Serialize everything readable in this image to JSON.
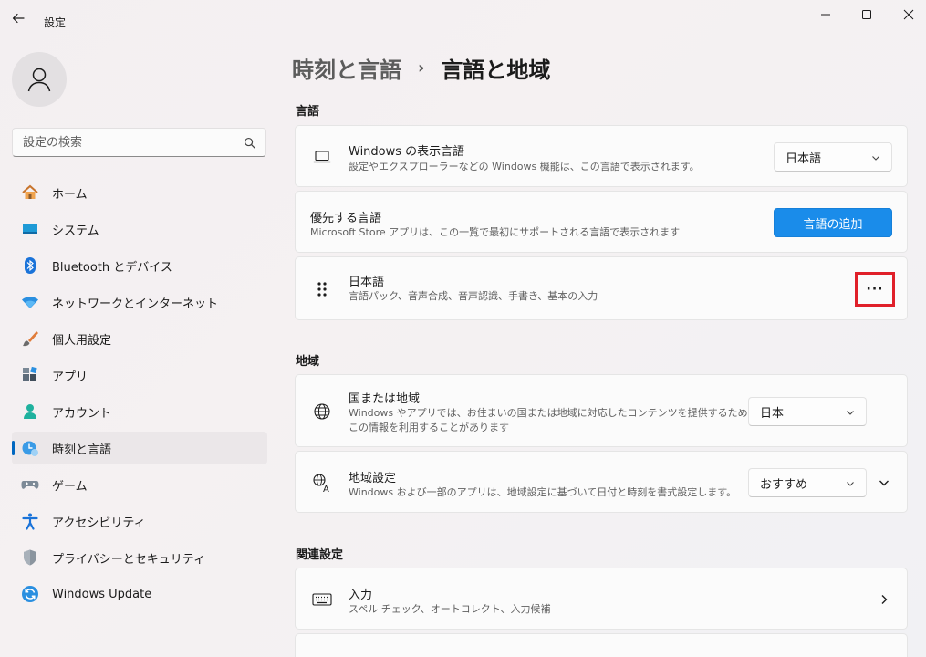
{
  "window": {
    "title": "設定",
    "back_icon": "back-arrow-icon",
    "controls": [
      "minimize-icon",
      "maximize-icon",
      "close-icon"
    ]
  },
  "sidebar": {
    "avatar_icon": "user-icon",
    "search": {
      "placeholder": "設定の検索",
      "value": ""
    },
    "items": [
      {
        "label": "ホーム",
        "icon": "home-icon"
      },
      {
        "label": "システム",
        "icon": "system-icon"
      },
      {
        "label": "Bluetooth とデバイス",
        "icon": "bluetooth-icon"
      },
      {
        "label": "ネットワークとインターネット",
        "icon": "wifi-icon"
      },
      {
        "label": "個人用設定",
        "icon": "brush-icon"
      },
      {
        "label": "アプリ",
        "icon": "apps-icon"
      },
      {
        "label": "アカウント",
        "icon": "account-icon"
      },
      {
        "label": "時刻と言語",
        "icon": "time-language-icon",
        "active": true
      },
      {
        "label": "ゲーム",
        "icon": "gamepad-icon"
      },
      {
        "label": "アクセシビリティ",
        "icon": "accessibility-icon"
      },
      {
        "label": "プライバシーとセキュリティ",
        "icon": "shield-icon"
      },
      {
        "label": "Windows Update",
        "icon": "update-icon"
      }
    ]
  },
  "main": {
    "breadcrumb": {
      "parent": "時刻と言語",
      "separator": "›",
      "current": "言語と地域"
    },
    "language_section": {
      "heading": "言語",
      "display_language": {
        "title": "Windows の表示言語",
        "desc": "設定やエクスプローラーなどの Windows 機能は、この言語で表示されます。",
        "value": "日本語",
        "icon": "laptop-icon"
      },
      "preferred": {
        "title": "優先する言語",
        "desc": "Microsoft Store アプリは、この一覧で最初にサポートされる言語で表示されます",
        "button": "言語の追加"
      },
      "japanese": {
        "title": "日本語",
        "desc": "言語パック、音声合成、音声認識、手書き、基本の入力",
        "more": "···",
        "icon": "drag-handle-icon"
      }
    },
    "region_section": {
      "heading": "地域",
      "country": {
        "title": "国または地域",
        "desc_line1": "Windows やアプリでは、お住まいの国または地域に対応したコンテンツを提供するために、",
        "desc_line2": "この情報を利用することがあります",
        "value": "日本",
        "icon": "globe-icon"
      },
      "format": {
        "title": "地域設定",
        "desc": "Windows および一部のアプリは、地域設定に基づいて日付と時刻を書式設定します。",
        "value": "おすすめ",
        "icon": "regional-format-icon"
      }
    },
    "related_section": {
      "heading": "関連設定",
      "input": {
        "title": "入力",
        "desc": "スペル チェック、オートコレクト、入力候補",
        "icon": "keyboard-icon"
      }
    }
  },
  "colors": {
    "accent": "#0067c0",
    "primary_button": "#1a8cea",
    "highlight_box": "#e0202a"
  }
}
